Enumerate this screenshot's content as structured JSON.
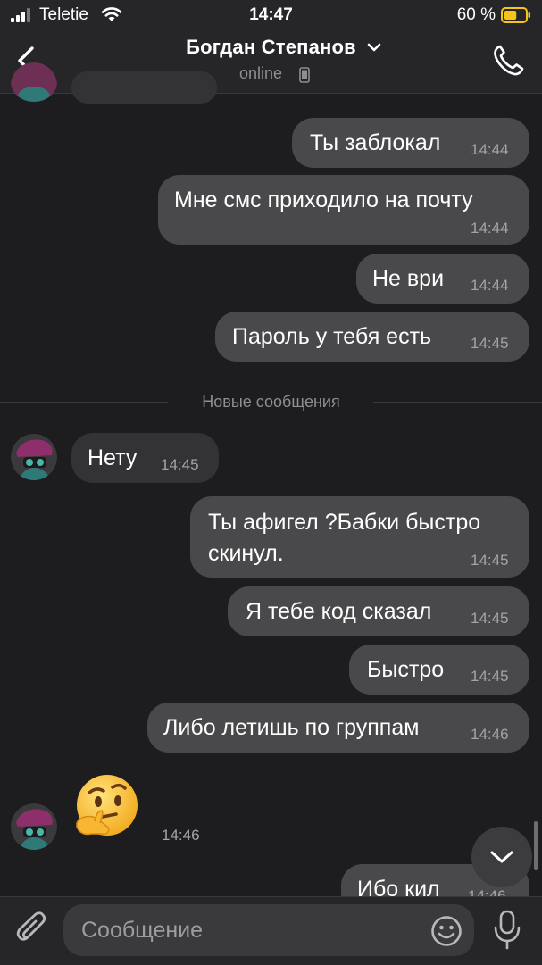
{
  "status_bar": {
    "carrier": "Teletie",
    "time": "14:47",
    "battery_percent": "60 %",
    "battery_level": 0.6,
    "icons": [
      "signal-icon",
      "wifi-icon",
      "battery-icon"
    ]
  },
  "header": {
    "contact_name": "Богдан Степанов",
    "status": "online",
    "icons": [
      "back-arrow-icon",
      "chevron-down-icon",
      "mobile-phone-icon",
      "phone-call-icon"
    ]
  },
  "messages": [
    {
      "direction": "out",
      "text": "Ты заблокал",
      "time": "14:44"
    },
    {
      "direction": "out",
      "text": "Мне смс приходило на почту",
      "time": "14:44"
    },
    {
      "direction": "out",
      "text": "Не ври",
      "time": "14:44"
    },
    {
      "direction": "out",
      "text": "Пароль у тебя есть",
      "time": "14:45"
    },
    {
      "direction": "in",
      "text": "Нету",
      "time": "14:45"
    },
    {
      "direction": "out",
      "text": "Ты афигел ?Бабки быстро",
      "text_line2": "скинул.",
      "time": "14:45"
    },
    {
      "direction": "out",
      "text": "Я тебе код сказал",
      "time": "14:45"
    },
    {
      "direction": "out",
      "text": "Быстро",
      "time": "14:45"
    },
    {
      "direction": "out",
      "text": "Либо летишь по группам",
      "time": "14:46"
    },
    {
      "direction": "in",
      "sticker": "thinking-face-emoji",
      "time": "14:46"
    },
    {
      "direction": "out",
      "text": "Ибо кил",
      "time": "14:46"
    }
  ],
  "divider": {
    "label": "Новые сообщения"
  },
  "input_bar": {
    "placeholder": "Сообщение",
    "icons": [
      "paperclip-icon",
      "emoji-icon",
      "microphone-icon"
    ]
  },
  "scroll_down_button": {
    "icon": "chevron-down-icon"
  },
  "colors": {
    "background": "#1d1d1f",
    "outgoing_bubble": "#49494b",
    "incoming_bubble": "#333335",
    "bars": "#262628",
    "secondary_text": "#8e8e93",
    "battery": "#f5c518"
  }
}
